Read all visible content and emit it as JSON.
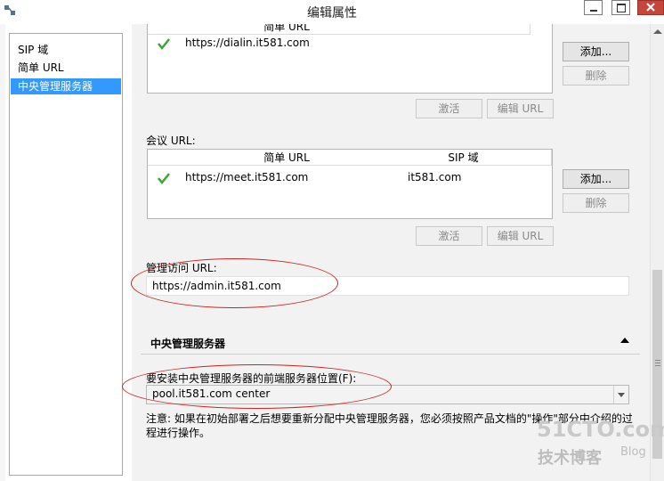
{
  "window": {
    "title": "编辑属性"
  },
  "sidebar": {
    "items": [
      {
        "label": "SIP 域"
      },
      {
        "label": "简单 URL"
      },
      {
        "label": "中央管理服务器",
        "selected": true
      }
    ]
  },
  "dialin": {
    "header_col1": "简单 URL",
    "row_url": "https://dialin.it581.com",
    "add_label": "添加...",
    "delete_label": "删除",
    "activate_label": "激活",
    "edit_url_label": "编辑 URL"
  },
  "meeting": {
    "label": "会议 URL:",
    "header_col1": "简单 URL",
    "header_col2": "SIP 域",
    "row_url": "https://meet.it581.com",
    "row_domain": "it581.com",
    "add_label": "添加...",
    "delete_label": "删除",
    "activate_label": "激活",
    "edit_url_label": "编辑 URL"
  },
  "admin": {
    "label": "管理访问 URL:",
    "value": "https://admin.it581.com"
  },
  "cms": {
    "section_title": "中央管理服务器",
    "frontend_label": "要安装中央管理服务器的前端服务器位置(F):",
    "frontend_value": "pool.it581.com    center",
    "note": "注意: 如果在初始部署之后想要重新分配中央管理服务器，您必须按照产品文档的\"操作\"部分中介绍的过程进行操作。"
  },
  "watermark": {
    "site": "51CTO.com",
    "blog_cn": "技术博客",
    "blog_en": "Blog"
  },
  "colors": {
    "selection": "#3399ff",
    "close_button": "#c7453b",
    "annotation": "#cc2222",
    "check": "#3aa63a"
  }
}
